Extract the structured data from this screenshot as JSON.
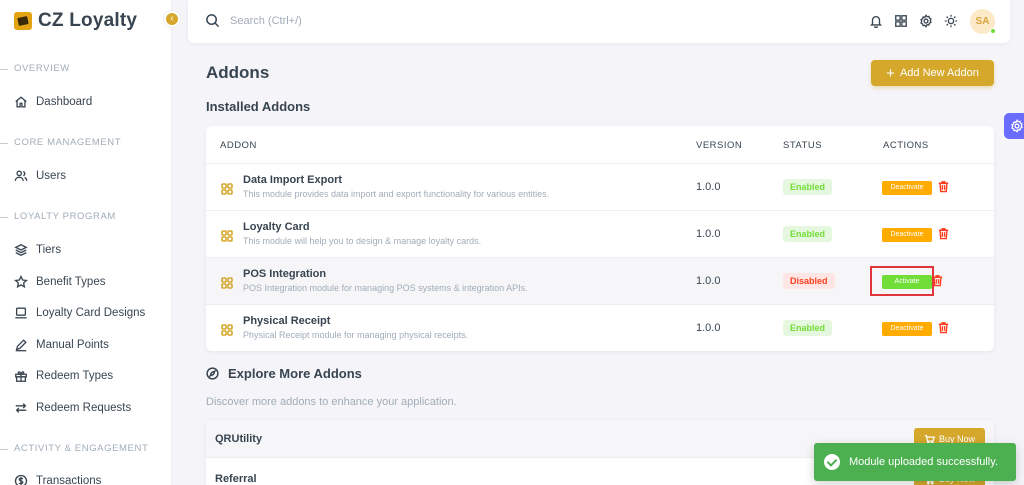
{
  "app": {
    "name": "CZ Loyalty"
  },
  "sidebar": {
    "sections": [
      {
        "title": "OVERVIEW",
        "items": [
          {
            "label": "Dashboard",
            "icon": "home-icon"
          }
        ]
      },
      {
        "title": "CORE MANAGEMENT",
        "items": [
          {
            "label": "Users",
            "icon": "users-icon"
          }
        ]
      },
      {
        "title": "LOYALTY PROGRAM",
        "items": [
          {
            "label": "Tiers",
            "icon": "layers-icon"
          },
          {
            "label": "Benefit Types",
            "icon": "star-icon"
          },
          {
            "label": "Loyalty Card Designs",
            "icon": "laptop-icon"
          },
          {
            "label": "Manual Points",
            "icon": "pencil-icon"
          },
          {
            "label": "Redeem Types",
            "icon": "gift-icon"
          },
          {
            "label": "Redeem Requests",
            "icon": "arrows-icon"
          }
        ]
      },
      {
        "title": "ACTIVITY & ENGAGEMENT",
        "items": [
          {
            "label": "Transactions",
            "icon": "dollar-icon"
          }
        ]
      }
    ]
  },
  "topbar": {
    "search_placeholder": "Search (Ctrl+/)",
    "avatar_initials": "SA"
  },
  "page": {
    "title": "Addons",
    "add_button_label": "Add New Addon",
    "installed_title": "Installed Addons"
  },
  "table": {
    "headers": {
      "addon": "ADDON",
      "version": "VERSION",
      "status": "STATUS",
      "actions": "ACTIONS"
    },
    "rows": [
      {
        "name": "Data Import Export",
        "description": "This module provides data import and export functionality for various entities.",
        "version": "1.0.0",
        "status": "Enabled",
        "action": "Deactivate"
      },
      {
        "name": "Loyalty Card",
        "description": "This module will help you to design & manage loyalty cards.",
        "version": "1.0.0",
        "status": "Enabled",
        "action": "Deactivate"
      },
      {
        "name": "POS Integration",
        "description": "POS Integration module for managing POS systems & integration APIs.",
        "version": "1.0.0",
        "status": "Disabled",
        "action": "Activate"
      },
      {
        "name": "Physical Receipt",
        "description": "Physical Receipt module for managing physical receipts.",
        "version": "1.0.0",
        "status": "Enabled",
        "action": "Deactivate"
      }
    ]
  },
  "explore": {
    "title": "Explore More Addons",
    "subtitle": "Discover more addons to enhance your application.",
    "items": [
      {
        "name": "QRUtility",
        "button": "Buy Now"
      },
      {
        "name": "Referral",
        "button": "Buy Now"
      }
    ]
  },
  "toast": {
    "message": "Module uploaded successfully."
  },
  "colors": {
    "accent": "#d5a82c",
    "enabled": "#71dd37",
    "disabled": "#ff3e1d",
    "deactivate": "#ffab00",
    "toast": "#4caf50",
    "settings_tab": "#696cff"
  }
}
